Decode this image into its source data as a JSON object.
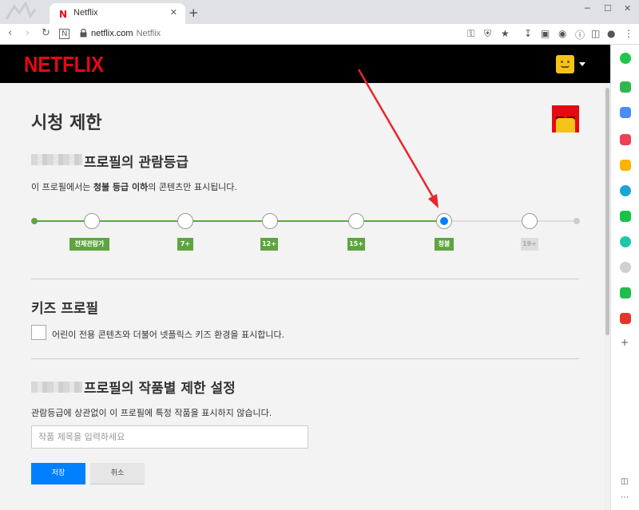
{
  "browser": {
    "tab_title": "Netflix",
    "tab_favicon": "N",
    "tab_close": "✕",
    "new_tab": "+",
    "url_host": "netflix.com",
    "url_sub": "Netflix",
    "window_controls": [
      "─",
      "☐",
      "✕"
    ]
  },
  "header": {
    "logo": "NETFLIX"
  },
  "page": {
    "title": "시청 제한"
  },
  "maturity": {
    "title": "프로필의 관람등급",
    "desc_prefix": "이 프로필에서는 ",
    "desc_bold": "청불 등급 이하",
    "desc_suffix": "의 콘텐츠만 표시됩니다.",
    "ratings": [
      "전체관람가",
      "7+",
      "12+",
      "15+",
      "청불",
      "19+"
    ],
    "selected_index": 4,
    "accent_color": "#5fa53f",
    "selected_color": "#0080ff"
  },
  "kids": {
    "title": "키즈 프로필",
    "checkbox_label": "어린이 전용 콘텐츠와 더불어 넷플릭스 키즈 환경을 표시합니다."
  },
  "restrictions": {
    "title": "프로필의 작품별 제한 설정",
    "desc": "관람등급에 상관없이 이 프로필에 특정 작품을 표시하지 않습니다.",
    "input_placeholder": "작품 제목을 입력하세요"
  },
  "buttons": {
    "save": "저장",
    "cancel": "취소"
  }
}
